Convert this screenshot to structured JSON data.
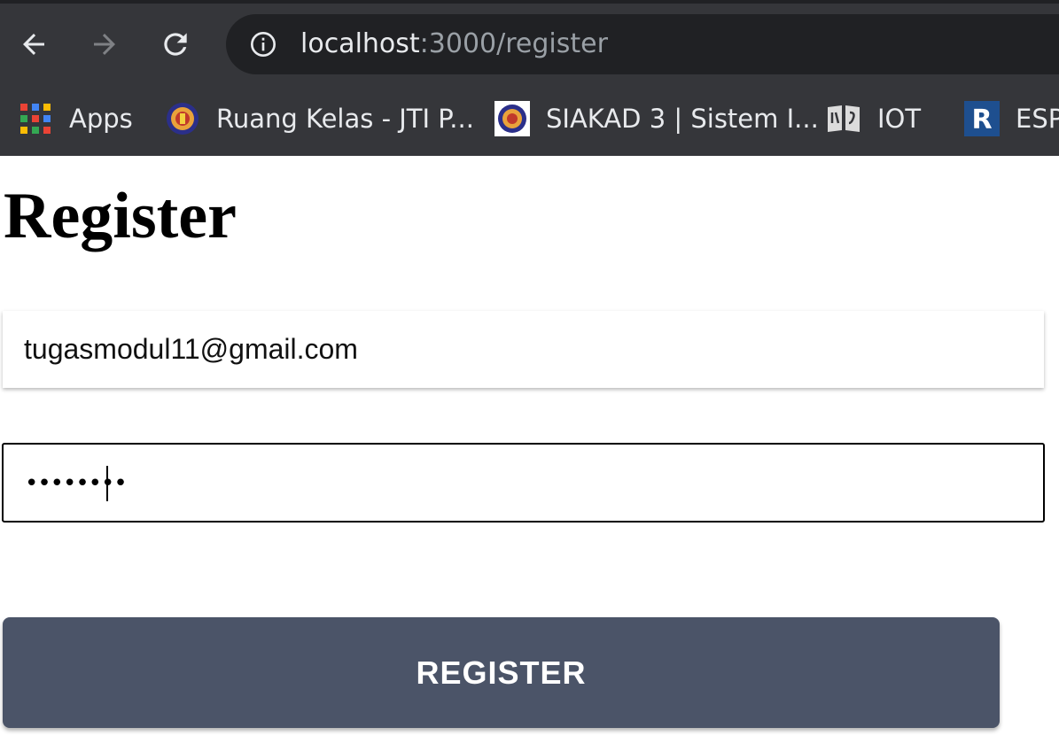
{
  "browser": {
    "url_host": "localhost",
    "url_path": ":3000/register",
    "bookmarks": [
      {
        "label": "Apps",
        "icon": "apps-grid-icon"
      },
      {
        "label": "Ruang Kelas - JTI P...",
        "icon": "university-crest-icon"
      },
      {
        "label": "SIAKAD 3 | Sistem I...",
        "icon": "university-crest-icon"
      },
      {
        "label": "IOT",
        "icon": "book-icon"
      },
      {
        "label": "ESP",
        "icon": "r-logo-icon"
      }
    ]
  },
  "page": {
    "title": "Register",
    "email": {
      "value": "tugasmodul11@gmail.com"
    },
    "password": {
      "masked_display": "••••••••"
    },
    "register_button_label": "REGISTER"
  },
  "colors": {
    "chrome_background": "#35363a",
    "omnibox_background": "#202124",
    "button_background": "#4b5468",
    "button_text": "#ffffff"
  }
}
